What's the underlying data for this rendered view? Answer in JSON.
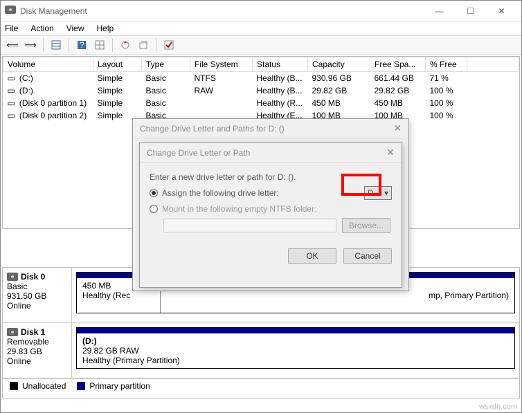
{
  "window": {
    "title": "Disk Management"
  },
  "menubar": [
    "File",
    "Action",
    "View",
    "Help"
  ],
  "table": {
    "cols": [
      "Volume",
      "Layout",
      "Type",
      "File System",
      "Status",
      "Capacity",
      "Free Spa...",
      "% Free"
    ],
    "rows": [
      {
        "vol": "(C:)",
        "layout": "Simple",
        "type": "Basic",
        "fs": "NTFS",
        "status": "Healthy (B...",
        "cap": "930.96 GB",
        "free": "661.44 GB",
        "pct": "71 %"
      },
      {
        "vol": "(D:)",
        "layout": "Simple",
        "type": "Basic",
        "fs": "RAW",
        "status": "Healthy (B...",
        "cap": "29.82 GB",
        "free": "29.82 GB",
        "pct": "100 %"
      },
      {
        "vol": "(Disk 0 partition 1)",
        "layout": "Simple",
        "type": "Basic",
        "fs": "",
        "status": "Healthy (R...",
        "cap": "450 MB",
        "free": "450 MB",
        "pct": "100 %"
      },
      {
        "vol": "(Disk 0 partition 2)",
        "layout": "Simple",
        "type": "Basic",
        "fs": "",
        "status": "Healthy (E...",
        "cap": "100 MB",
        "free": "100 MB",
        "pct": "100 %"
      }
    ]
  },
  "disks": {
    "d0": {
      "name": "Disk 0",
      "kind": "Basic",
      "size": "931.50 GB",
      "state": "Online",
      "p1size": "450 MB",
      "p1status": "Healthy (Rec",
      "trail": "mp, Primary Partition)"
    },
    "d1": {
      "name": "Disk 1",
      "kind": "Removable",
      "size": "29.83 GB",
      "state": "Online",
      "label": "(D:)",
      "desc": "29.82 GB RAW",
      "status": "Healthy (Primary Partition)"
    }
  },
  "legend": {
    "unalloc": "Unallocated",
    "primary": "Primary partition"
  },
  "dialog1": {
    "title": "Change Drive Letter and Paths for D: ()",
    "ok": "OK",
    "cancel": "Cancel"
  },
  "dialog2": {
    "title": "Change Drive Letter or Path",
    "prompt": "Enter a new drive letter or path for D: ().",
    "opt_assign": "Assign the following drive letter:",
    "opt_mount": "Mount in the following empty NTFS folder:",
    "browse": "Browse...",
    "letter": "D",
    "ok": "OK",
    "cancel": "Cancel"
  },
  "watermark": "wsxdn.com"
}
